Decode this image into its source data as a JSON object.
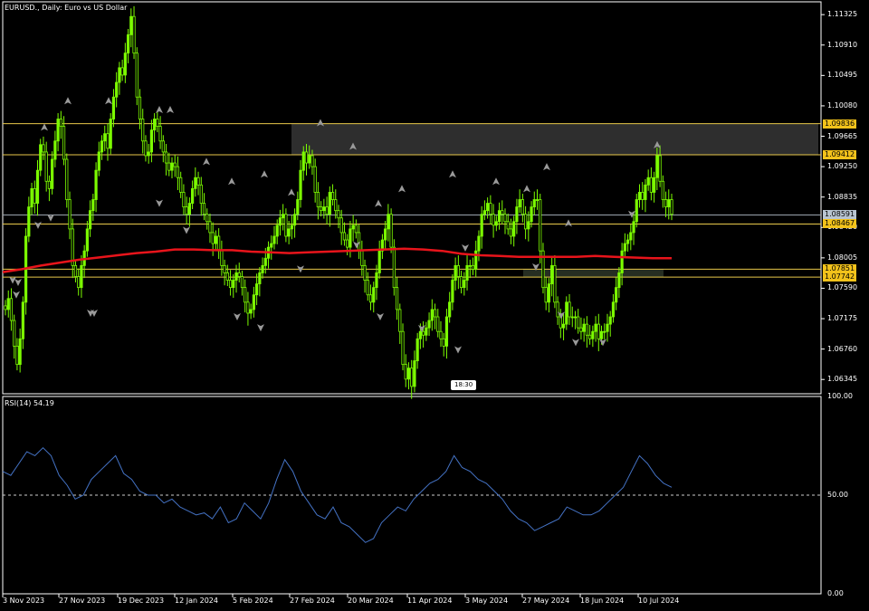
{
  "header": {
    "symbol": "EURUSD.",
    "timeframe": "Daily",
    "description": "Euro vs US Dollar",
    "title": "EURUSD., Daily:  Euro vs US Dollar"
  },
  "rsi_header": "RSI(14) 54.19",
  "timestamp_badge": "18:30",
  "colors": {
    "background": "#000000",
    "candle": "#7CFC00",
    "moving_average": "#E8141B",
    "rsi_line": "#4472C4",
    "level_line": "#E8C84A",
    "zone": "#3A3A3A",
    "arrow": "#9A9A9A"
  },
  "price_axis": {
    "ticks": [
      "1.11325",
      "1.10910",
      "1.10495",
      "1.10080",
      "1.09665",
      "1.09250",
      "1.08835",
      "1.08420",
      "1.08005",
      "1.07590",
      "1.07175",
      "1.06760",
      "1.06345"
    ]
  },
  "price_tags": [
    {
      "label": "1.09836",
      "value": 1.09836,
      "kind": "level"
    },
    {
      "label": "1.09412",
      "value": 1.09412,
      "kind": "level"
    },
    {
      "label": "1.08591",
      "value": 1.08591,
      "kind": "current"
    },
    {
      "label": "1.08467",
      "value": 1.08467,
      "kind": "level"
    },
    {
      "label": "1.07851",
      "value": 1.07851,
      "kind": "level"
    },
    {
      "label": "1.07742",
      "value": 1.07742,
      "kind": "level"
    }
  ],
  "rsi_axis": {
    "ticks": [
      "100.00",
      "50.00",
      "0.00"
    ]
  },
  "time_axis": {
    "labels": [
      "3 Nov 2023",
      "27 Nov 2023",
      "19 Dec 2023",
      "12 Jan 2024",
      "5 Feb 2024",
      "27 Feb 2024",
      "20 Mar 2024",
      "11 Apr 2024",
      "3 May 2024",
      "27 May 2024",
      "18 Jun 2024",
      "10 Jul 2024"
    ]
  },
  "chart_data": [
    {
      "type": "candlestick",
      "title": "EURUSD., Daily:  Euro vs US Dollar",
      "x_labels": [
        "3 Nov 2023",
        "27 Nov 2023",
        "19 Dec 2023",
        "12 Jan 2024",
        "5 Feb 2024",
        "27 Feb 2024",
        "20 Mar 2024",
        "11 Apr 2024",
        "3 May 2024",
        "27 May 2024",
        "18 Jun 2024",
        "10 Jul 2024"
      ],
      "ylim": [
        1.0615,
        1.115
      ],
      "close_series": [
        1.073,
        1.0745,
        1.0715,
        1.068,
        1.0655,
        1.069,
        1.074,
        1.083,
        1.087,
        1.0895,
        1.0875,
        1.092,
        1.0955,
        1.0945,
        1.0905,
        1.0895,
        1.0935,
        1.096,
        1.099,
        1.098,
        1.0935,
        1.088,
        1.084,
        1.079,
        1.0775,
        1.076,
        1.079,
        1.081,
        1.084,
        1.0865,
        1.088,
        1.092,
        1.0945,
        1.096,
        1.097,
        1.095,
        1.099,
        1.102,
        1.104,
        1.106,
        1.105,
        1.108,
        1.1105,
        1.113,
        1.108,
        1.102,
        1.099,
        1.096,
        1.094,
        1.0945,
        1.0975,
        1.099,
        1.098,
        1.096,
        1.0945,
        1.093,
        1.092,
        1.093,
        1.0925,
        1.091,
        1.089,
        1.087,
        1.086,
        1.0875,
        1.0895,
        1.091,
        1.09,
        1.0875,
        1.086,
        1.085,
        1.0835,
        1.082,
        1.083,
        1.081,
        1.079,
        1.078,
        1.077,
        1.076,
        1.077,
        1.078,
        1.0775,
        1.076,
        1.074,
        1.0725,
        1.073,
        1.075,
        1.0765,
        1.078,
        1.079,
        1.08,
        1.0815,
        1.082,
        1.083,
        1.0845,
        1.0855,
        1.086,
        1.083,
        1.084,
        1.0845,
        1.086,
        1.088,
        1.092,
        1.0945,
        1.093,
        1.094,
        1.0925,
        1.089,
        1.087,
        1.0865,
        1.087,
        1.086,
        1.089,
        1.088,
        1.0865,
        1.0855,
        1.0835,
        1.0825,
        1.0815,
        1.084,
        1.0845,
        1.0835,
        1.081,
        1.079,
        1.077,
        1.075,
        1.074,
        1.076,
        1.078,
        1.081,
        1.0825,
        1.084,
        1.086,
        1.0815,
        1.076,
        1.073,
        1.07,
        1.0655,
        1.0635,
        1.065,
        1.0625,
        1.066,
        1.069,
        1.07,
        1.0695,
        1.0705,
        1.0715,
        1.073,
        1.072,
        1.07,
        1.069,
        1.068,
        1.072,
        1.074,
        1.077,
        1.079,
        1.0775,
        1.076,
        1.077,
        1.079,
        1.079,
        1.0785,
        1.081,
        1.083,
        1.086,
        1.0865,
        1.0875,
        1.086,
        1.0845,
        1.085,
        1.0865,
        1.086,
        1.085,
        1.084,
        1.083,
        1.085,
        1.087,
        1.088,
        1.086,
        1.084,
        1.085,
        1.087,
        1.088,
        1.088,
        1.081,
        1.076,
        1.074,
        1.0765,
        1.079,
        1.074,
        1.072,
        1.0705,
        1.071,
        1.074,
        1.072,
        1.072,
        1.072,
        1.0705,
        1.07,
        1.071,
        1.0695,
        1.069,
        1.07,
        1.071,
        1.069,
        1.07,
        1.07,
        1.071,
        1.072,
        1.074,
        1.076,
        1.078,
        1.081,
        1.082,
        1.0825,
        1.0835,
        1.085,
        1.088,
        1.089,
        1.088,
        1.09,
        1.091,
        1.089,
        1.091,
        1.094,
        1.0905,
        1.088,
        1.087,
        1.088,
        1.086
      ],
      "series": [
        {
          "name": "",
          "type": "moving-average",
          "values": [
            1.0781,
            1.0785,
            1.079,
            1.0794,
            1.0798,
            1.0801,
            1.0804,
            1.0807,
            1.0809,
            1.0812,
            1.0812,
            1.0811,
            1.0811,
            1.0809,
            1.0808,
            1.0807,
            1.0808,
            1.0809,
            1.081,
            1.0811,
            1.0812,
            1.0813,
            1.0812,
            1.081,
            1.0806,
            1.0804,
            1.0803,
            1.0802,
            1.0802,
            1.0802,
            1.0802,
            1.0803,
            1.0802,
            1.0801,
            1.08,
            1.08
          ]
        },
        {
          "name": "RSI(14)",
          "type": "line",
          "last_value": 54.19,
          "ylim": [
            0,
            100
          ],
          "reference": 50,
          "values": [
            62,
            60,
            66,
            72,
            70,
            74,
            70,
            60,
            55,
            48,
            50,
            58,
            62,
            66,
            70,
            61,
            58,
            52,
            50,
            50,
            46,
            48,
            44,
            42,
            40,
            41,
            38,
            44,
            36,
            38,
            46,
            42,
            38,
            46,
            58,
            68,
            62,
            52,
            46,
            40,
            38,
            44,
            36,
            34,
            30,
            26,
            28,
            36,
            40,
            44,
            42,
            48,
            52,
            56,
            58,
            62,
            70,
            64,
            62,
            58,
            56,
            52,
            48,
            42,
            38,
            36,
            32,
            34,
            36,
            38,
            44,
            42,
            40,
            40,
            42,
            46,
            50,
            54,
            62,
            70,
            66,
            60,
            56,
            54
          ]
        }
      ]
    }
  ]
}
